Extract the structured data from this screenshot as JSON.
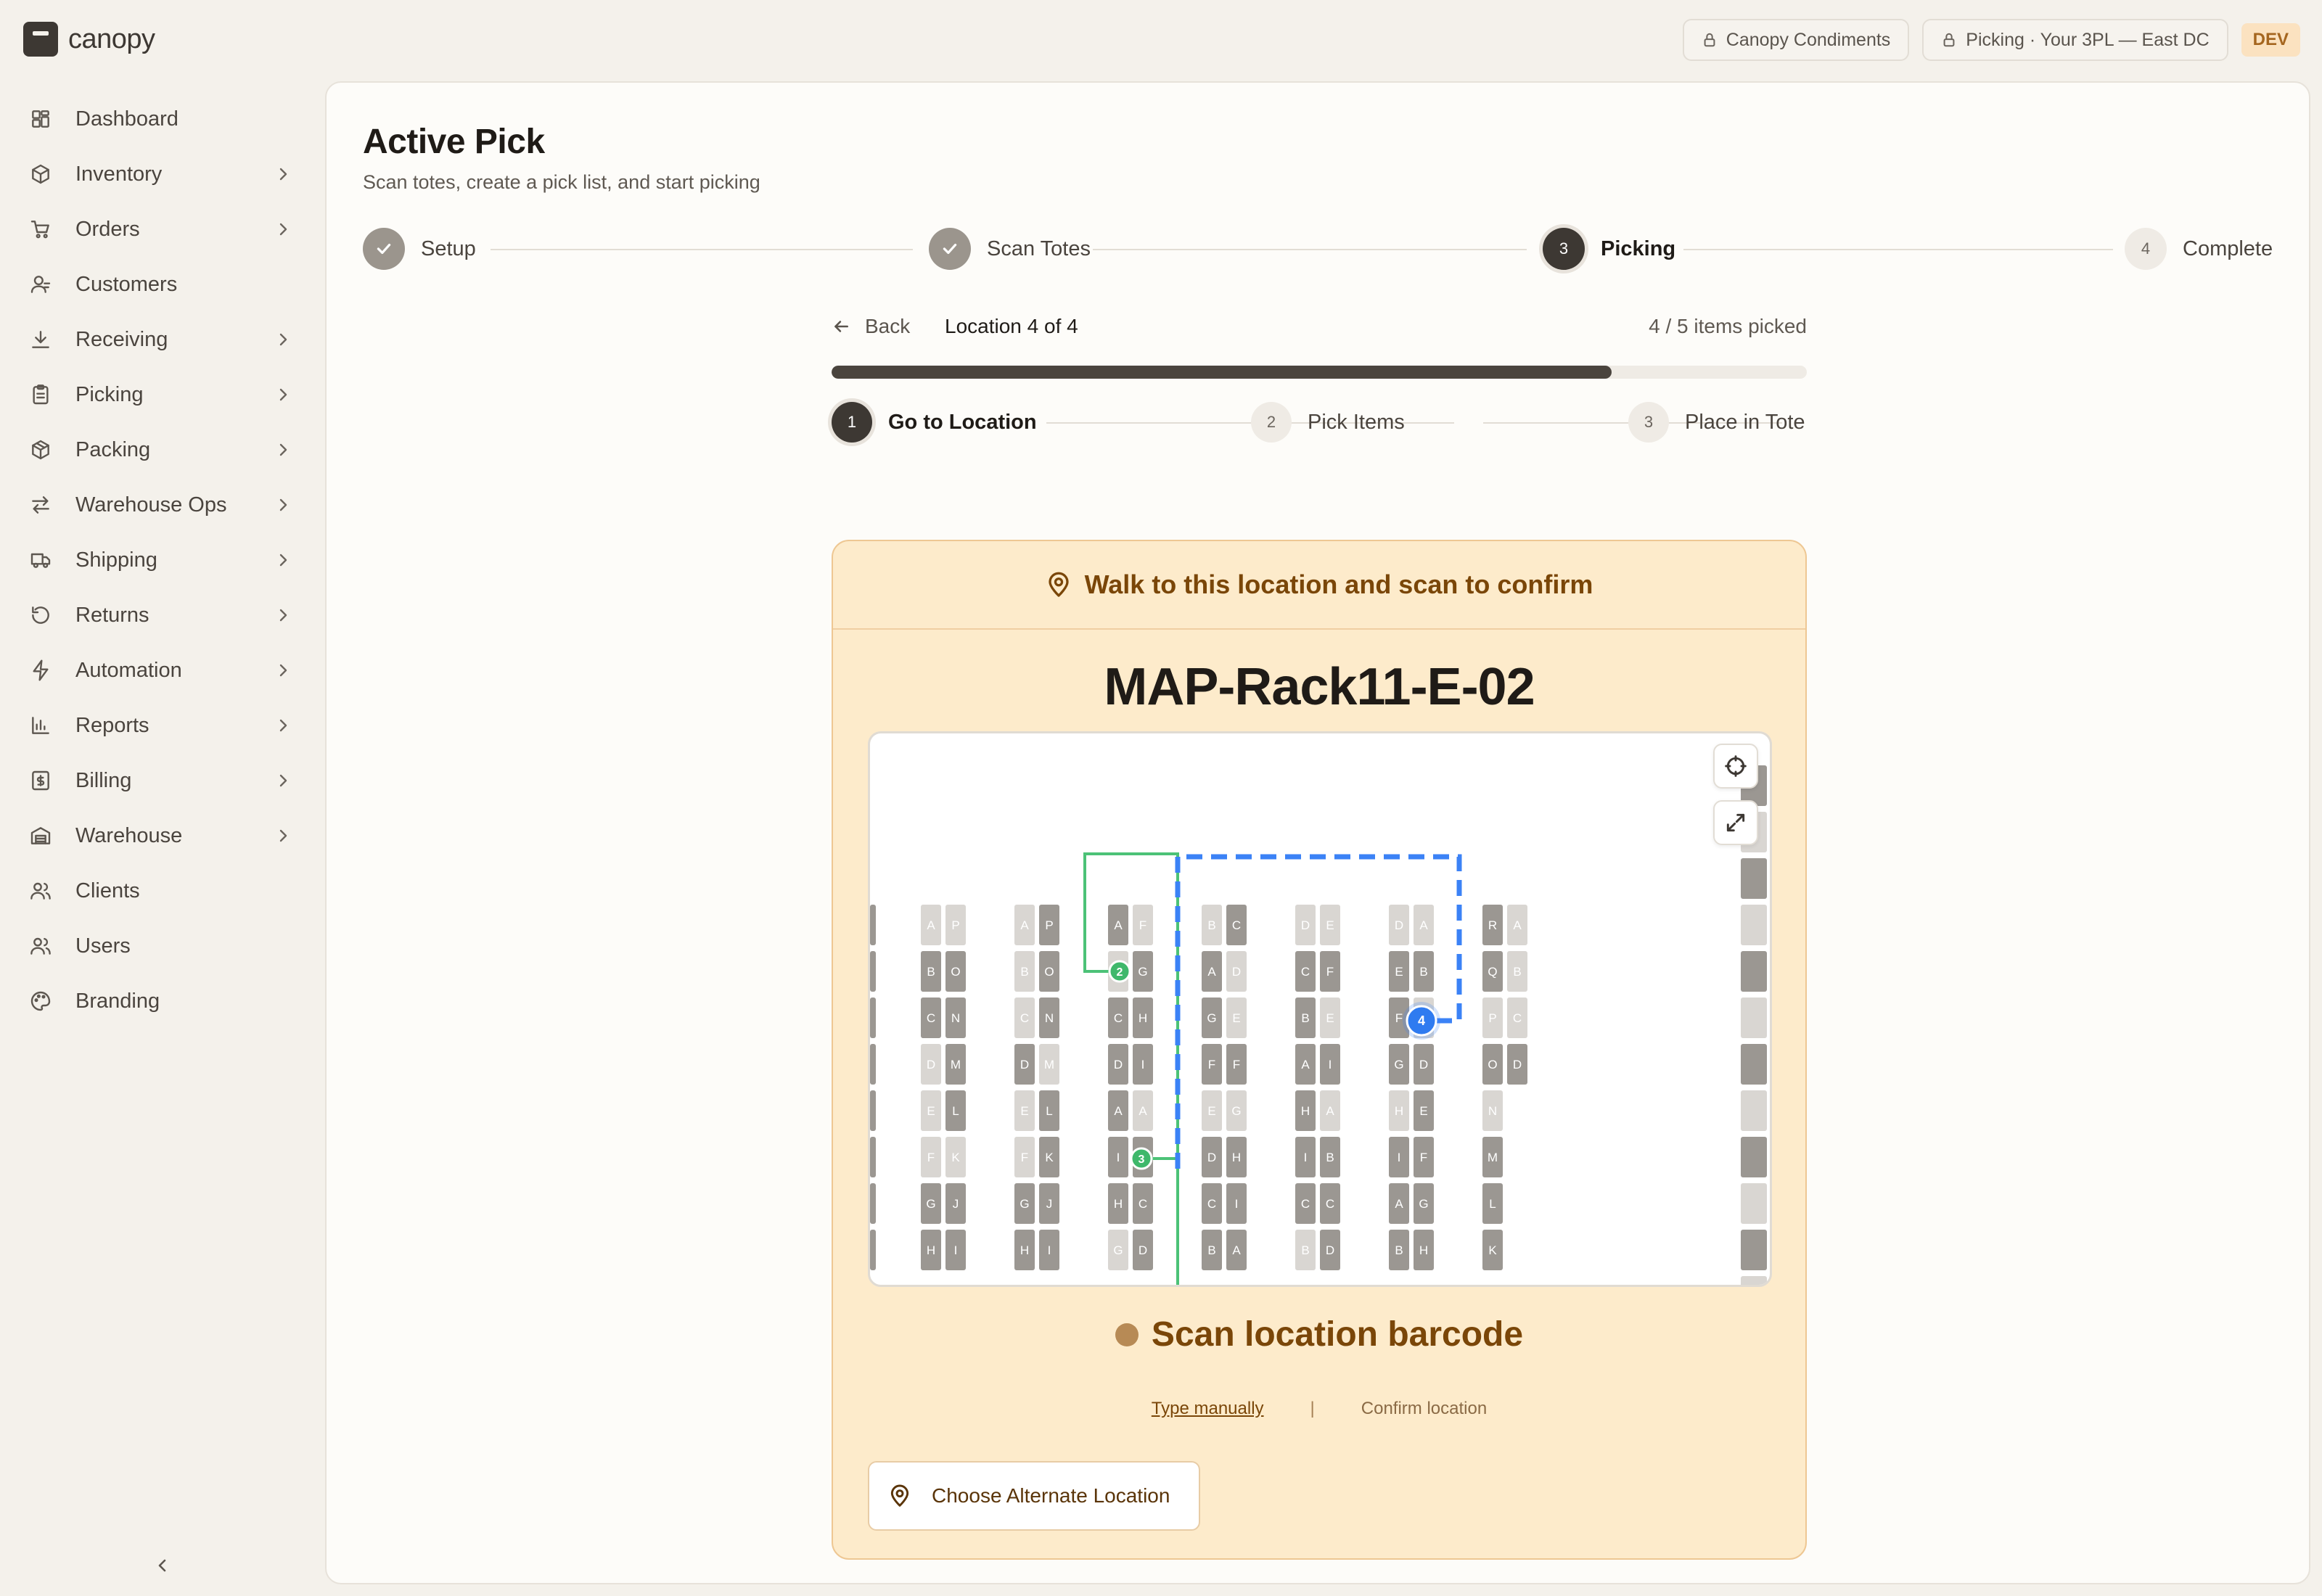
{
  "brand": {
    "name": "canopy"
  },
  "sidebar": {
    "items": [
      {
        "label": "Dashboard",
        "icon": "dashboard-icon",
        "has_children": false
      },
      {
        "label": "Inventory",
        "icon": "box-icon",
        "has_children": true
      },
      {
        "label": "Orders",
        "icon": "cart-icon",
        "has_children": true
      },
      {
        "label": "Customers",
        "icon": "customer-icon",
        "has_children": false
      },
      {
        "label": "Receiving",
        "icon": "download-icon",
        "has_children": true
      },
      {
        "label": "Picking",
        "icon": "clipboard-icon",
        "has_children": true
      },
      {
        "label": "Packing",
        "icon": "package-icon",
        "has_children": true
      },
      {
        "label": "Warehouse Ops",
        "icon": "swap-icon",
        "has_children": true
      },
      {
        "label": "Shipping",
        "icon": "truck-icon",
        "has_children": true
      },
      {
        "label": "Returns",
        "icon": "return-icon",
        "has_children": true
      },
      {
        "label": "Automation",
        "icon": "bolt-icon",
        "has_children": true
      },
      {
        "label": "Reports",
        "icon": "chart-icon",
        "has_children": true
      },
      {
        "label": "Billing",
        "icon": "billing-icon",
        "has_children": true
      },
      {
        "label": "Warehouse",
        "icon": "warehouse-icon",
        "has_children": true
      },
      {
        "label": "Clients",
        "icon": "clients-icon",
        "has_children": false
      },
      {
        "label": "Users",
        "icon": "users-icon",
        "has_children": false
      },
      {
        "label": "Branding",
        "icon": "palette-icon",
        "has_children": false
      }
    ]
  },
  "topbar": {
    "client": "Canopy Condiments",
    "context": "Picking · Your 3PL — East DC",
    "env_badge": "DEV"
  },
  "page": {
    "title": "Active Pick",
    "subtitle": "Scan totes, create a pick list, and start picking"
  },
  "stepper": [
    {
      "label": "Setup",
      "state": "done",
      "number": "1"
    },
    {
      "label": "Scan Totes",
      "state": "done",
      "number": "2"
    },
    {
      "label": "Picking",
      "state": "active",
      "number": "3"
    },
    {
      "label": "Complete",
      "state": "pending",
      "number": "4"
    }
  ],
  "pick": {
    "back_label": "Back",
    "location_counter": "Location 4 of 4",
    "items_picked": "4 / 5 items picked",
    "progress_fraction": 0.8,
    "substeps": [
      {
        "number": "1",
        "label": "Go to Location",
        "state": "active"
      },
      {
        "number": "2",
        "label": "Pick Items",
        "state": "pending"
      },
      {
        "number": "3",
        "label": "Place in Tote",
        "state": "pending"
      }
    ],
    "instruction": "Walk to this location and scan to confirm",
    "location_code": "MAP-Rack11-E-02",
    "scan_prompt": "Scan location barcode",
    "type_manually": "Type manually",
    "separator": "|",
    "confirm_location": "Confirm location",
    "alternate_button": "Choose Alternate Location"
  },
  "map": {
    "route_stops": [
      "2",
      "3",
      "4"
    ],
    "current_stop": "4",
    "colors": {
      "completed_route": "#4cc277",
      "next_route": "#3b82f6",
      "bin_dark": "#9b9792",
      "bin_light": "#d9d6d2"
    },
    "racks": [
      {
        "left": [
          "A",
          "B",
          "C",
          "D",
          "E",
          "F",
          "G",
          "H"
        ],
        "right": [
          "P",
          "O",
          "N",
          "M",
          "L",
          "K",
          "J",
          "I"
        ]
      },
      {
        "left": [
          "A",
          "B",
          "C",
          "D",
          "E",
          "F",
          "G",
          "H"
        ],
        "right": [
          "P",
          "O",
          "N",
          "M",
          "L",
          "K",
          "J",
          "I"
        ]
      },
      {
        "left": [
          "A",
          "",
          "C",
          "D",
          "A",
          "I",
          "H",
          "G"
        ],
        "right": [
          "F",
          "G",
          "H",
          "I",
          "A",
          "",
          "C",
          "D"
        ]
      },
      {
        "left": [
          "B",
          "A",
          "G",
          "F",
          "E",
          "D",
          "C",
          "B"
        ],
        "right": [
          "C",
          "D",
          "E",
          "F",
          "G",
          "H",
          "I",
          "A"
        ]
      },
      {
        "left": [
          "D",
          "C",
          "B",
          "A",
          "H",
          "I",
          "C",
          "B"
        ],
        "right": [
          "E",
          "F",
          "E",
          "I",
          "A",
          "B",
          "C",
          "D"
        ]
      },
      {
        "left": [
          "D",
          "E",
          "F",
          "G",
          "H",
          "I",
          "A",
          "B"
        ],
        "right": [
          "A",
          "B",
          "",
          "D",
          "E",
          "F",
          "G",
          "H"
        ]
      },
      {
        "left": [
          "R",
          "Q",
          "P",
          "O",
          "N",
          "M",
          "L",
          "K"
        ],
        "right": [
          "A",
          "B",
          "C",
          "D",
          "",
          "",
          "",
          ""
        ]
      }
    ]
  }
}
